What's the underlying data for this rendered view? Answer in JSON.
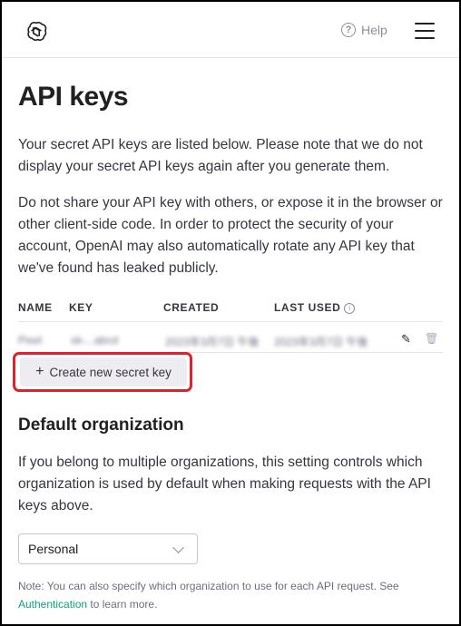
{
  "header": {
    "logo": "openai-logo",
    "help_label": "Help",
    "help_icon_glyph": "?"
  },
  "page": {
    "title": "API keys",
    "intro": "Your secret API keys are listed below. Please note that we do not display your secret API keys again after you generate them.",
    "warning": "Do not share your API key with others, or expose it in the browser or other client-side code. In order to protect the security of your account, OpenAI may also automatically rotate any API key that we've found has leaked publicly."
  },
  "table": {
    "columns": [
      "NAME",
      "KEY",
      "CREATED",
      "LAST USED"
    ],
    "info_icon_glyph": "i",
    "rows": [
      {
        "name": "Pixel",
        "key": "sk-...abcd",
        "created": "2023年3月7日 午後",
        "last_used": "2023年3月7日 午後"
      }
    ],
    "edit_icon": "✎",
    "delete_icon": "🗑"
  },
  "create_button": {
    "icon": "+",
    "label": "Create new secret key"
  },
  "default_org": {
    "title": "Default organization",
    "description": "If you belong to multiple organizations, this setting controls which organization is used by default when making requests with the API keys above.",
    "selected": "Personal"
  },
  "note": {
    "before": "Note: You can also specify which organization to use for each API request. See ",
    "link": "Authentication",
    "after": " to learn more."
  },
  "colors": {
    "accent_link": "#10a37f",
    "highlight_border": "#e0202a",
    "button_bg": "#ececf1"
  }
}
